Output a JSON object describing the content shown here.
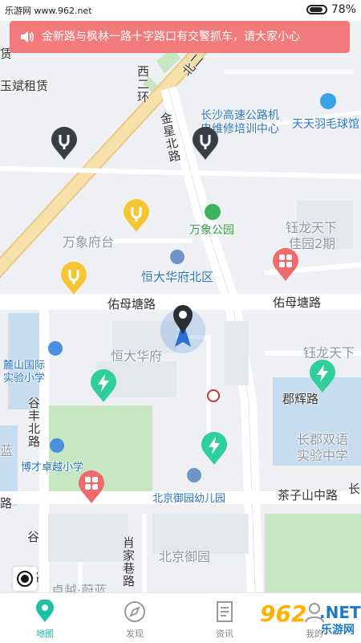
{
  "status_bar": {
    "site": "乐游网 www.962.net",
    "battery_pct": "78%"
  },
  "notice": {
    "text": "金新路与枫林一路十字路口有交警抓车，请大家小心"
  },
  "map": {
    "labels": {
      "guang": "赁",
      "yubin": "玉斌租赁",
      "xierhuan": "西二环",
      "bei": "北二",
      "jinxing": "金星北路",
      "changsha1": "长沙高速公路机",
      "changsha2": "电维修培训中心",
      "tiantian": "天天羽毛球馆",
      "wanxiang_park": "万象公园",
      "wanxiang_fu": "万象府台",
      "yulong1": "钰龙天下",
      "yulong2": "佳园2期",
      "hengda_north": "恒大华府北区",
      "youmu_w": "佑母塘路",
      "youmu_e": "佑母塘路",
      "hengda": "恒大华府",
      "yulong3": "钰龙天下",
      "lushan1": "麓山国际",
      "lushan2": "实验小学",
      "gufeng": "谷丰北路",
      "junhui": "郡辉路",
      "changjun1": "长郡双语",
      "changjun2": "实验中学",
      "lan": "蓝",
      "bocai": "博才卓越小学",
      "beijing_kg": "北京御园幼儿园",
      "chazishan": "茶子山中路",
      "chang_edge": "长",
      "lu_w": "路",
      "gu2": "谷",
      "lu2": "路",
      "xiaojia": "肖家巷路",
      "beijing_yuan": "北京御园",
      "zhuoyue": "卓越·蔚蓝"
    }
  },
  "tabs": [
    {
      "label": "地图",
      "icon": "map-pin-icon",
      "active": true
    },
    {
      "label": "发现",
      "icon": "compass-icon",
      "active": false
    },
    {
      "label": "资讯",
      "icon": "document-icon",
      "active": false
    },
    {
      "label": "我的",
      "icon": "user-icon",
      "active": false
    }
  ],
  "watermark": {
    "number": "962",
    "net": ".NET",
    "cn": "乐游网"
  },
  "colors": {
    "accent": "#19c1a6",
    "notice_bg": "#f27a7a",
    "pin_dark": "#3a3d44",
    "pin_yellow": "#f5c533",
    "pin_green": "#2ecf9a",
    "pin_red": "#ef6b6b"
  }
}
